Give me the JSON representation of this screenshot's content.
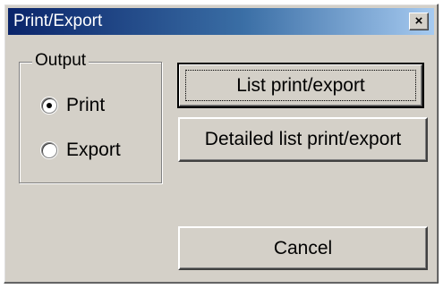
{
  "window": {
    "title": "Print/Export",
    "close_glyph": "×"
  },
  "output_group": {
    "legend": "Output",
    "options": [
      {
        "label": "Print",
        "selected": true
      },
      {
        "label": "Export",
        "selected": false
      }
    ]
  },
  "buttons": {
    "list_print_export": "List print/export",
    "detailed_list_print_export": "Detailed list print/export",
    "cancel": "Cancel"
  },
  "icons": {
    "close": "close-icon",
    "radio_selected": "radio-selected-icon",
    "radio_unselected": "radio-unselected-icon"
  },
  "colors": {
    "dialog_bg": "#d4d0c8",
    "titlebar_start": "#0a246a",
    "titlebar_end": "#a6caf0",
    "title_text": "#ffffff"
  }
}
